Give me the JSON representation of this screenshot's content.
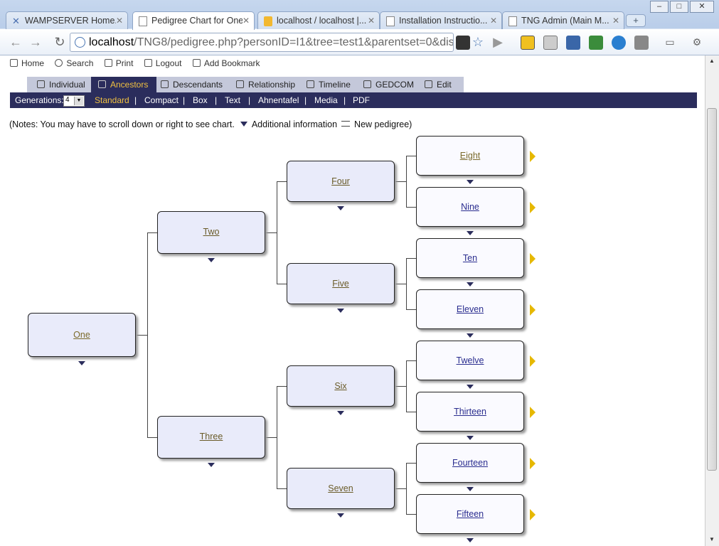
{
  "browser": {
    "tabs": [
      {
        "label": "WAMPSERVER Home..."
      },
      {
        "label": "Pedigree Chart for One"
      },
      {
        "label": "localhost / localhost |..."
      },
      {
        "label": "Installation Instructio..."
      },
      {
        "label": "TNG Admin (Main M..."
      }
    ],
    "address_host": "localhost",
    "address_path": "/TNG8/pedigree.php?personID=I1&tree=test1&parentset=0&displa"
  },
  "topnav": {
    "home": "Home",
    "search": "Search",
    "print": "Print",
    "logout": "Logout",
    "bookmark": "Add Bookmark"
  },
  "pagetabs": {
    "individual": "Individual",
    "ancestors": "Ancestors",
    "descendants": "Descendants",
    "relationship": "Relationship",
    "timeline": "Timeline",
    "gedcom": "GEDCOM",
    "edit": "Edit"
  },
  "subbar": {
    "generations_label": "Generations:",
    "generations_value": "4",
    "standard": "Standard",
    "compact": "Compact",
    "box": "Box",
    "text": "Text",
    "ahnentafel": "Ahnentafel",
    "media": "Media",
    "pdf": "PDF",
    "sep": "|"
  },
  "notes": {
    "text": "(Notes: You may have to scroll down or right to see chart.",
    "additional": "Additional information",
    "new_pedigree": "New pedigree)"
  },
  "people": {
    "p1": "One",
    "p2": "Two",
    "p3": "Three",
    "p4": "Four",
    "p5": "Five",
    "p6": "Six",
    "p7": "Seven",
    "p8": "Eight",
    "p9": "Nine",
    "p10": "Ten",
    "p11": "Eleven",
    "p12": "Twelve",
    "p13": "Thirteen",
    "p14": "Fourteen",
    "p15": "Fifteen"
  }
}
